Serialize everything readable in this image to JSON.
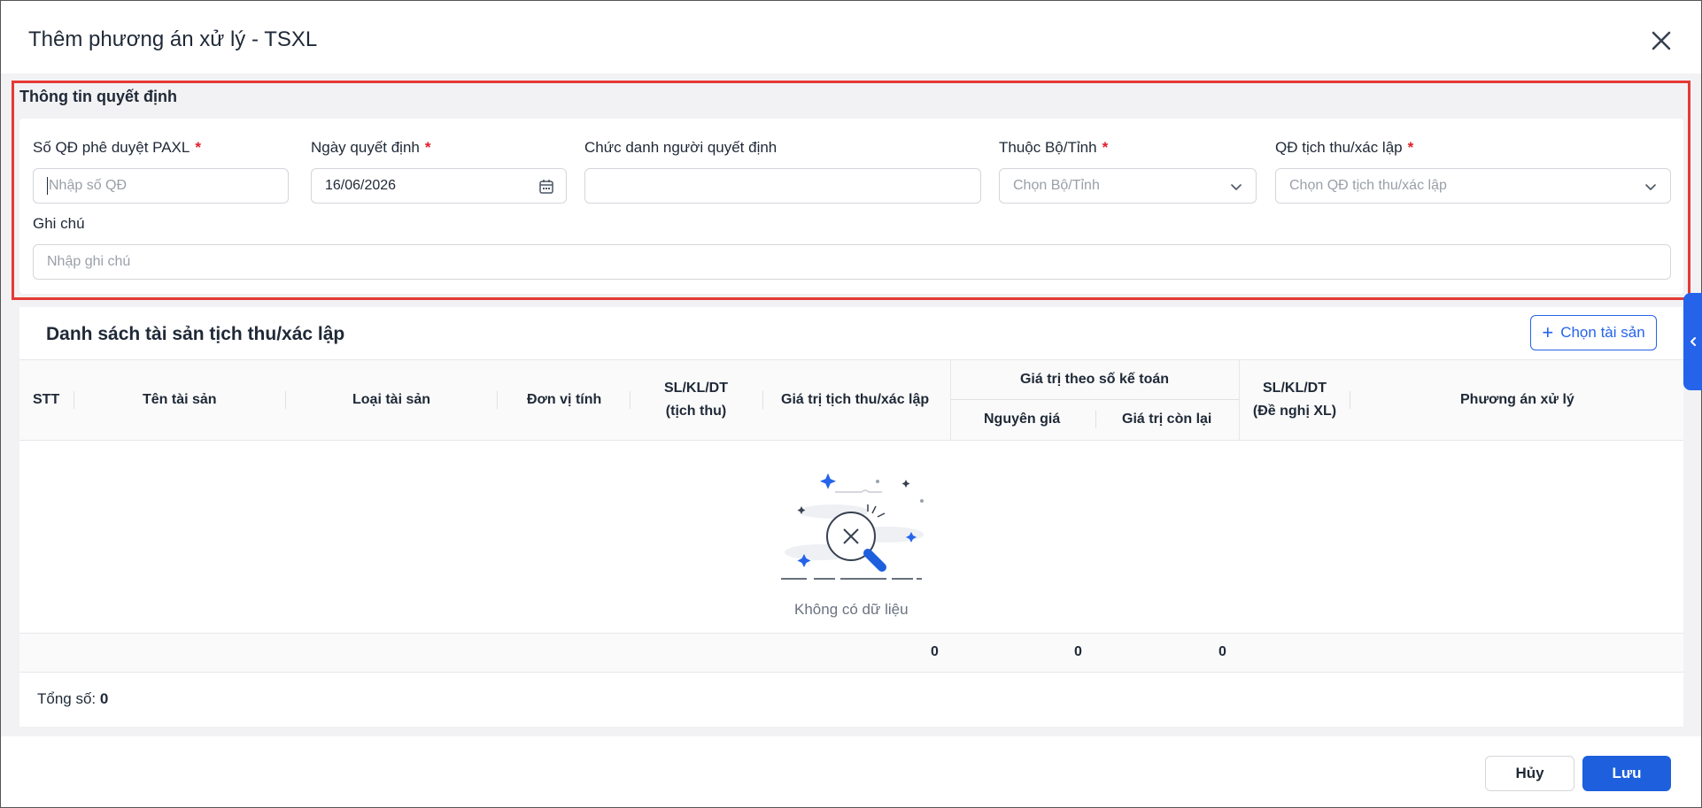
{
  "dialog": {
    "title": "Thêm phương án xử lý - TSXL"
  },
  "decision_section": {
    "title": "Thông tin quyết định",
    "fields": {
      "so_qd": {
        "label": "Số QĐ phê duyệt PAXL",
        "required": "*",
        "placeholder": "Nhập số QĐ",
        "value": ""
      },
      "ngay_qd": {
        "label": "Ngày quyết định",
        "required": "*",
        "value": "16/06/2026"
      },
      "chuc_danh": {
        "label": "Chức danh người quyết định",
        "value": ""
      },
      "bo_tinh": {
        "label": "Thuộc Bộ/Tỉnh",
        "required": "*",
        "placeholder": "Chọn Bộ/Tỉnh"
      },
      "qd_tich_thu": {
        "label": "QĐ tịch thu/xác lập",
        "required": "*",
        "placeholder": "Chọn QĐ tịch thu/xác lập"
      },
      "ghi_chu": {
        "label": "Ghi chú",
        "placeholder": "Nhập ghi chú",
        "value": ""
      }
    }
  },
  "asset_list": {
    "title": "Danh sách tài sản tịch thu/xác lập",
    "choose_button": "Chọn tài sản",
    "columns": {
      "stt": "STT",
      "ten": "Tên tài sản",
      "loai": "Loại tài sản",
      "dvt": "Đơn vị tính",
      "sl_tich_thu_1": "SL/KL/DT",
      "sl_tich_thu_2": "(tịch thu)",
      "gia_tri_tt": "Giá trị tịch thu/xác lập",
      "group_ke_toan": "Giá trị theo số kế toán",
      "nguyen_gia": "Nguyên giá",
      "con_lai": "Giá trị còn lại",
      "sl_de_nghi_1": "SL/KL/DT",
      "sl_de_nghi_2": "(Đề nghị XL)",
      "phuong_an": "Phương án xử lý"
    },
    "empty_text": "Không có dữ liệu",
    "summary": {
      "gia_tri_tt": "0",
      "nguyen_gia": "0",
      "con_lai": "0"
    },
    "total_label": "Tổng số:",
    "total_value": "0"
  },
  "footer": {
    "cancel": "Hủy",
    "save": "Lưu"
  },
  "colors": {
    "primary": "#1d5fdd",
    "highlight_border": "#e53935",
    "required": "#e11d2a"
  }
}
